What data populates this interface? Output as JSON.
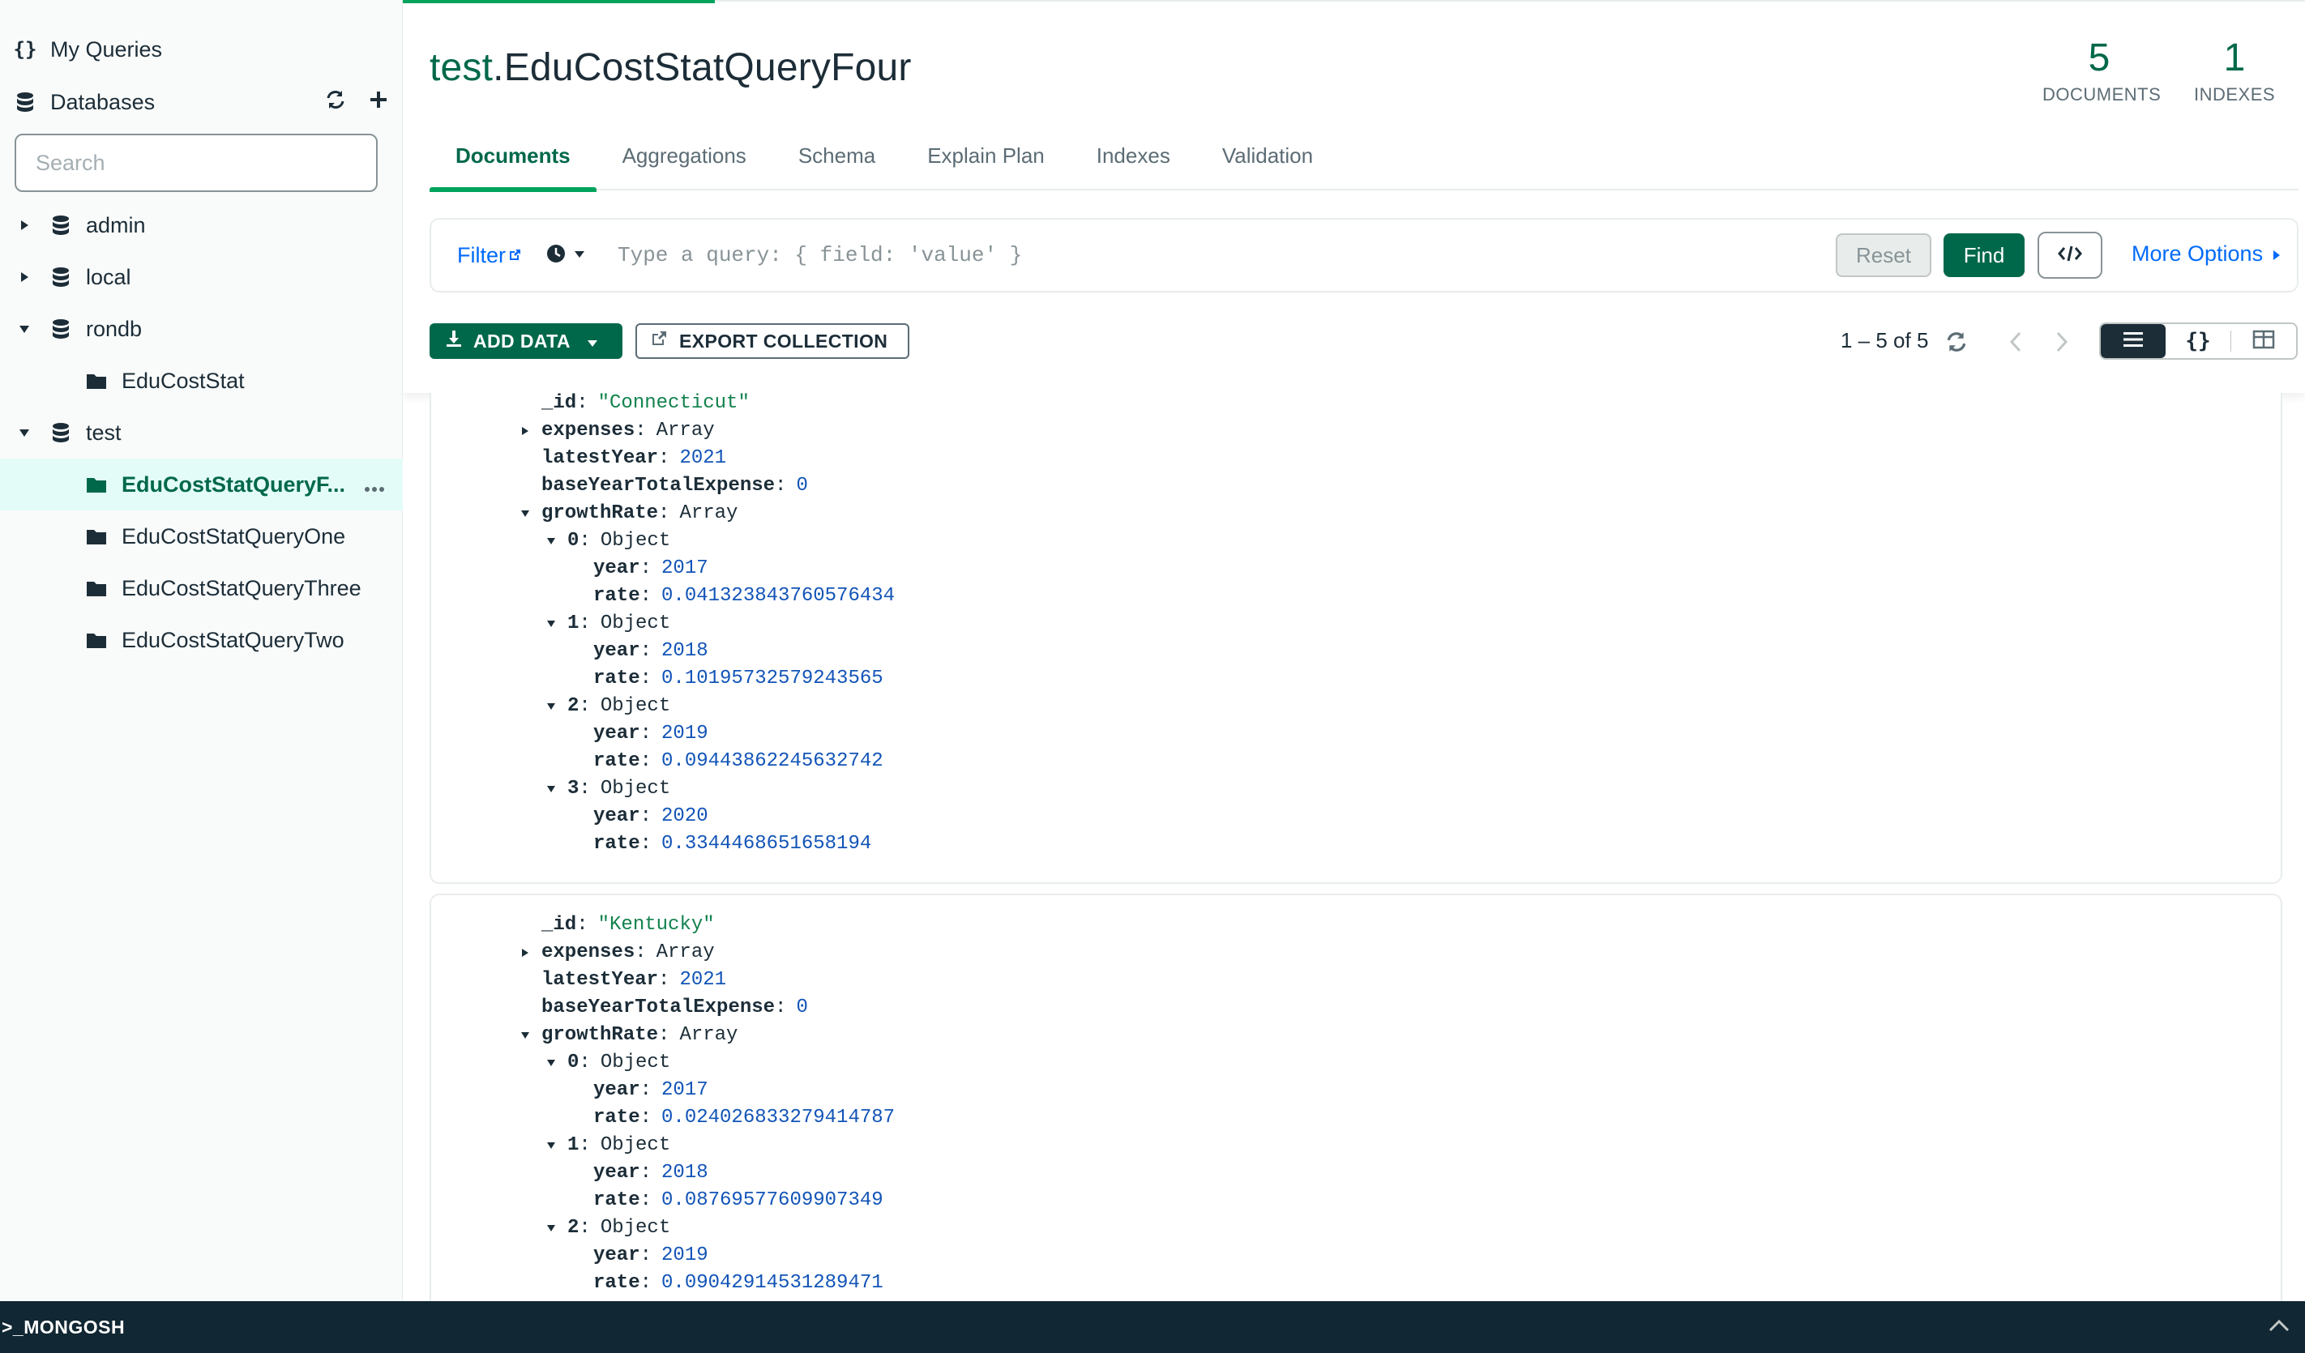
{
  "sidebar": {
    "my_queries": "My Queries",
    "databases": "Databases",
    "search_placeholder": "Search",
    "databases_list": [
      {
        "name": "admin"
      },
      {
        "name": "local"
      },
      {
        "name": "rondb",
        "collections": [
          "EduCostStat"
        ]
      },
      {
        "name": "test",
        "collections": [
          "EduCostStatQueryF...",
          "EduCostStatQueryOne",
          "EduCostStatQueryThree",
          "EduCostStatQueryTwo"
        ]
      }
    ]
  },
  "header": {
    "db": "test",
    "collection": ".EduCostStatQueryFour",
    "documents_count": "5",
    "documents_label": "DOCUMENTS",
    "indexes_count": "1",
    "indexes_label": "INDEXES"
  },
  "tabs": [
    "Documents",
    "Aggregations",
    "Schema",
    "Explain Plan",
    "Indexes",
    "Validation"
  ],
  "query": {
    "filter_label": "Filter",
    "placeholder": "Type a query: { field: 'value' }",
    "reset": "Reset",
    "find": "Find",
    "more_options": "More Options"
  },
  "toolbar": {
    "add_data": "ADD DATA",
    "export": "EXPORT COLLECTION",
    "pager": "1 – 5 of 5"
  },
  "documents": [
    {
      "id": "\"Connecticut\"",
      "expenses": "Array",
      "latestYear": "2021",
      "baseYearTotalExpense": "0",
      "growthRate": "Array",
      "rates": [
        {
          "idx": "0",
          "type": "Object",
          "year": "2017",
          "rate": "0.041323843760576434"
        },
        {
          "idx": "1",
          "type": "Object",
          "year": "2018",
          "rate": "0.10195732579243565"
        },
        {
          "idx": "2",
          "type": "Object",
          "year": "2019",
          "rate": "0.09443862245632742"
        },
        {
          "idx": "3",
          "type": "Object",
          "year": "2020",
          "rate": "0.3344468651658194"
        }
      ]
    },
    {
      "id": "\"Kentucky\"",
      "expenses": "Array",
      "latestYear": "2021",
      "baseYearTotalExpense": "0",
      "growthRate": "Array",
      "rates": [
        {
          "idx": "0",
          "type": "Object",
          "year": "2017",
          "rate": "0.024026833279414787"
        },
        {
          "idx": "1",
          "type": "Object",
          "year": "2018",
          "rate": "0.08769577609907349"
        },
        {
          "idx": "2",
          "type": "Object",
          "year": "2019",
          "rate": "0.09042914531289471"
        }
      ]
    }
  ],
  "fields": {
    "id": "_id",
    "expenses": "expenses",
    "latestYear": "latestYear",
    "baseYearTotalExpense": "baseYearTotalExpense",
    "growthRate": "growthRate",
    "year": "year",
    "rate": "rate"
  },
  "shell": {
    "label": ">_MONGOSH"
  },
  "colors": {
    "brand_green": "#00684a",
    "accent_green": "#00a35c",
    "link_blue": "#016bf8",
    "shell_bg": "#112733"
  }
}
